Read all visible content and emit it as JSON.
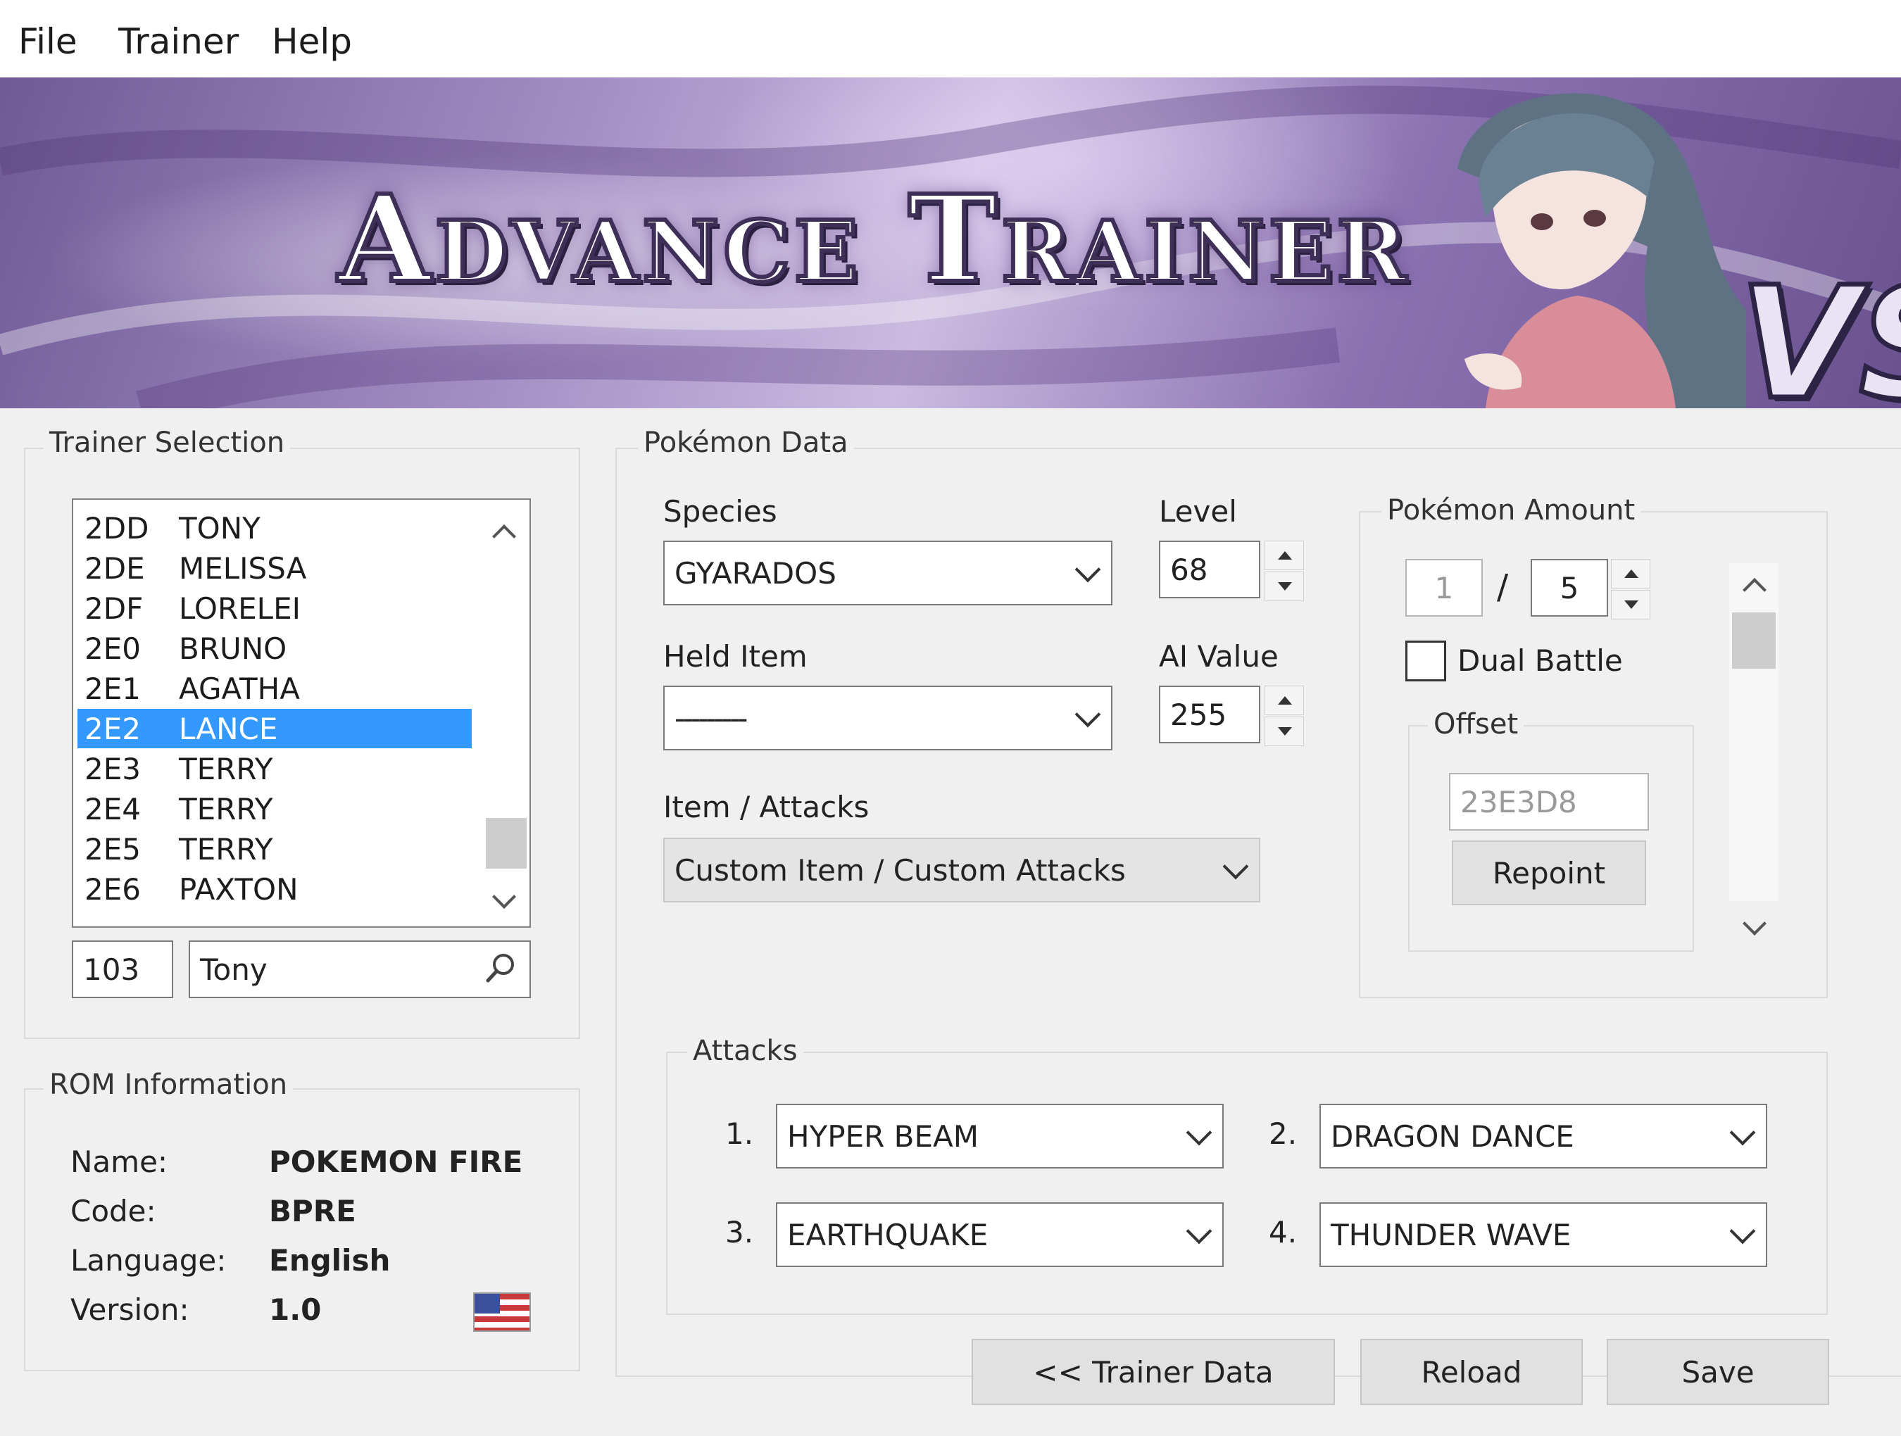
{
  "menu": {
    "items": [
      "File",
      "Trainer",
      "Help"
    ]
  },
  "banner": {
    "title": "Advance Trainer",
    "vs": "VS"
  },
  "trainer_selection": {
    "label": "Trainer Selection",
    "list": [
      {
        "id": "2DD",
        "name": "TONY"
      },
      {
        "id": "2DE",
        "name": "MELISSA"
      },
      {
        "id": "2DF",
        "name": "LORELEI"
      },
      {
        "id": "2E0",
        "name": "BRUNO"
      },
      {
        "id": "2E1",
        "name": "AGATHA"
      },
      {
        "id": "2E2",
        "name": "LANCE"
      },
      {
        "id": "2E3",
        "name": "TERRY"
      },
      {
        "id": "2E4",
        "name": "TERRY"
      },
      {
        "id": "2E5",
        "name": "TERRY"
      },
      {
        "id": "2E6",
        "name": "PAXTON"
      }
    ],
    "selected_index": 5,
    "number_value": "103",
    "search_value": "Tony"
  },
  "rom_info": {
    "label": "ROM Information",
    "rows": [
      {
        "key": "Name:",
        "value": "POKEMON FIRE"
      },
      {
        "key": "Code:",
        "value": "BPRE"
      },
      {
        "key": "Language:",
        "value": "English"
      },
      {
        "key": "Version:",
        "value": "1.0"
      }
    ]
  },
  "pokemon_data": {
    "label": "Pokémon Data",
    "species_label": "Species",
    "species_value": "GYARADOS",
    "level_label": "Level",
    "level_value": "68",
    "held_item_label": "Held Item",
    "held_item_value": "---------",
    "ai_label": "AI Value",
    "ai_value": "255",
    "item_attacks_label": "Item / Attacks",
    "item_attacks_value": "Custom Item / Custom Attacks"
  },
  "pokemon_amount": {
    "label": "Pokémon Amount",
    "current": "1",
    "separator": "/",
    "total": "5",
    "dual_battle_label": "Dual Battle",
    "dual_battle_checked": false,
    "offset_label": "Offset",
    "offset_value": "23E3D8",
    "repoint_label": "Repoint"
  },
  "attacks": {
    "label": "Attacks",
    "moves": [
      {
        "num": "1.",
        "value": "HYPER BEAM"
      },
      {
        "num": "2.",
        "value": "DRAGON DANCE"
      },
      {
        "num": "3.",
        "value": "EARTHQUAKE"
      },
      {
        "num": "4.",
        "value": "THUNDER WAVE"
      }
    ]
  },
  "footer": {
    "trainer_data_label": "<< Trainer Data",
    "reload_label": "Reload",
    "save_label": "Save"
  }
}
